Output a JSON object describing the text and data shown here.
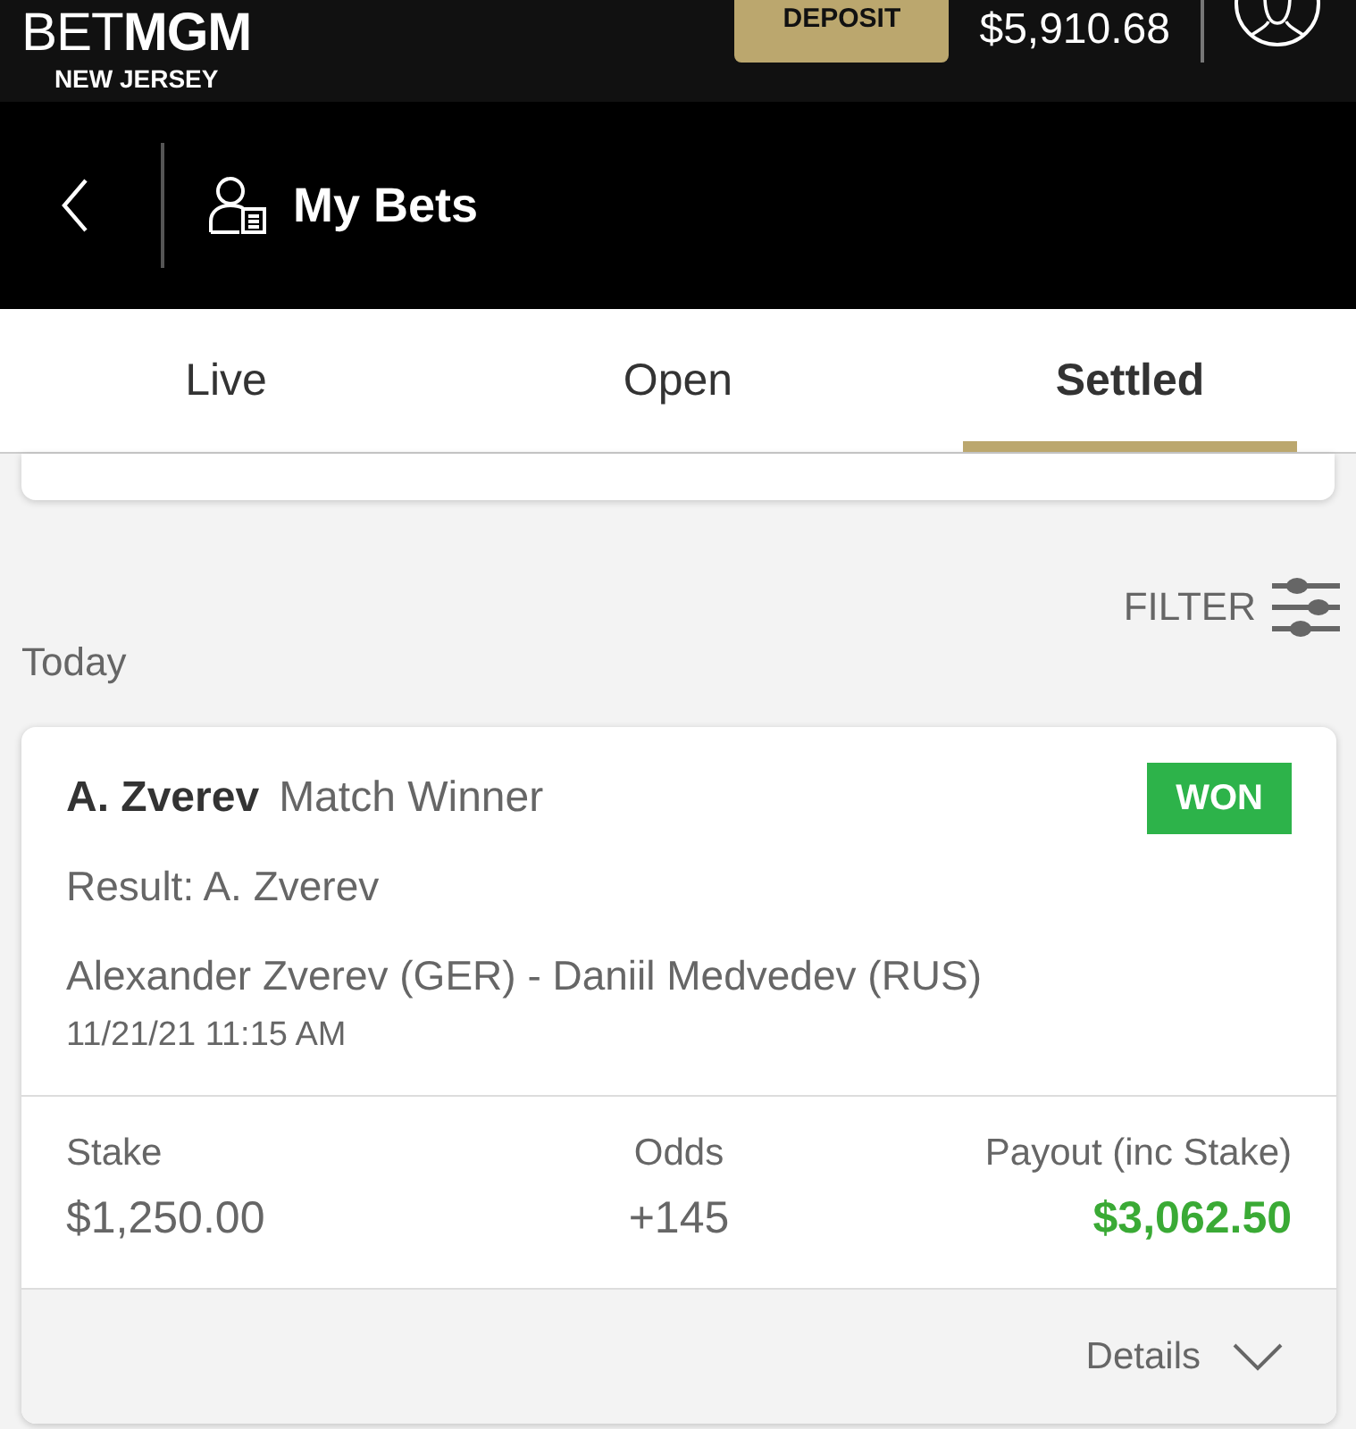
{
  "top_bar": {
    "logo": "BET**MGM**",
    "region": "NEW JERSEY",
    "deposit_button": "DEPOSIT",
    "balance": "$5,910.68"
  },
  "header": {
    "title": "My Bets"
  },
  "tabs": [
    {
      "label": "Live",
      "selected": false
    },
    {
      "label": "Open",
      "selected": false
    },
    {
      "label": "Settled",
      "selected": true
    }
  ],
  "filter": {
    "label": "FILTER"
  },
  "section": {
    "heading": "Today"
  },
  "bets": [
    {
      "selection": "A. Zverev",
      "market": "Match Winner",
      "status": "WON",
      "result": "Result: A. Zverev",
      "event": "Alexander Zverev (GER) - Daniil Medvedev (RUS)",
      "datetime": "11/21/21 11:15 AM",
      "stats": [
        {
          "label": "Stake",
          "value": "$1,250.00",
          "kind": "plain"
        },
        {
          "label": "Odds",
          "value": "+145",
          "kind": "plain"
        },
        {
          "label": "Payout (inc Stake)",
          "value": "$3,062.50",
          "kind": "highlight"
        }
      ],
      "details_label": "Details"
    }
  ]
}
